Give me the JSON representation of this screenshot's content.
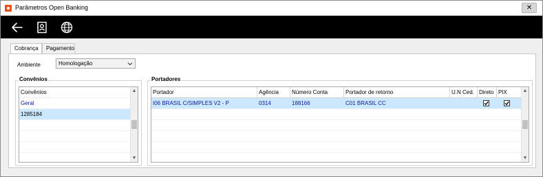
{
  "window": {
    "title": "Parâmetros Open Banking",
    "close_glyph": "✕"
  },
  "toolbar": {
    "icons": [
      "back-arrow-icon",
      "contact-book-icon",
      "globe-icon"
    ]
  },
  "tabs": [
    {
      "label": "Cobrança",
      "active": true
    },
    {
      "label": "Pagamento",
      "active": false
    }
  ],
  "ambiente": {
    "label": "Ambiente",
    "value": "Homologação"
  },
  "convenios": {
    "title": "Convênios",
    "items": [
      {
        "label": "Convênios",
        "style": "header"
      },
      {
        "label": "Geral",
        "style": "blue"
      },
      {
        "label": "1285184",
        "style": "selected"
      }
    ]
  },
  "portadores": {
    "title": "Portadores",
    "columns": [
      "Portador",
      "Agência",
      "Número Conta",
      "Portador de retorno",
      "U.N Ced.",
      "Direto",
      "PIX"
    ],
    "rows": [
      {
        "portador": "I06  BRASIL C/SIMPLES V2 - P",
        "agencia": "0314",
        "numero_conta": "188166",
        "portador_retorno": "C01  BRASIL CC",
        "un_ced": "",
        "direto": true,
        "pix": true
      }
    ]
  },
  "colors": {
    "selection": "#cce8ff",
    "link_blue": "#0a1a99",
    "toolbar_bg": "#000000"
  }
}
